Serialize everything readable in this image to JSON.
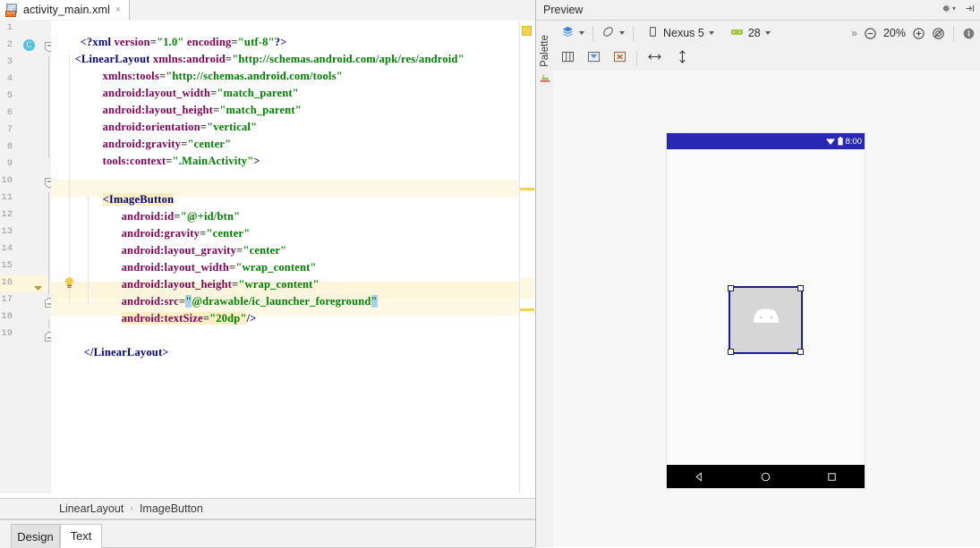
{
  "editor": {
    "tab": {
      "filename": "activity_main.xml",
      "close": "×",
      "icon": "xml-file-icon"
    },
    "line_numbers": [
      "1",
      "2",
      "3",
      "4",
      "5",
      "6",
      "7",
      "8",
      "9",
      "10",
      "11",
      "12",
      "13",
      "14",
      "15",
      "16",
      "17",
      "18",
      "19"
    ],
    "code": {
      "l1": "<?xml version=\"1.0\" encoding=\"utf-8\"?>",
      "l2": "<LinearLayout xmlns:android=\"http://schemas.android.com/apk/res/android\"",
      "l3": "xmlns:tools=\"http://schemas.android.com/tools\"",
      "l4": "android:layout_width=\"match_parent\"",
      "l5": "android:layout_height=\"match_parent\"",
      "l6": "android:orientation=\"vertical\"",
      "l7": "android:gravity=\"center\"",
      "l8": "tools:context=\".MainActivity\">",
      "l9": "",
      "l10": "<ImageButton",
      "l11": "android:id=\"@+id/btn\"",
      "l12": "android:gravity=\"center\"",
      "l13": "android:layout_gravity=\"center\"",
      "l14": "android:layout_width=\"wrap_content\"",
      "l15": "android:layout_height=\"wrap_content\"",
      "l16": "android:src=\"@drawable/ic_launcher_foreground\"",
      "l17": "android:textSize=\"20dp\"/>",
      "l18": "",
      "l19": "</LinearLayout>"
    },
    "tokens": {
      "pi_open": "<?xml",
      "pi_close": "?>",
      "attr_version": "version",
      "val_version": "\"1.0\"",
      "attr_encoding": "encoding",
      "val_encoding": "\"utf-8\"",
      "tag_linearlayout_open": "<LinearLayout",
      "tag_linearlayout_close": "</LinearLayout>",
      "tag_imagebutton": "<ImageButton",
      "ns_android": "xmlns:android",
      "ns_tools": "xmlns:tools",
      "val_android_ns": "\"http://schemas.android.com/apk/res/android\"",
      "val_tools_ns": "\"http://schemas.android.com/tools\"",
      "a_layout_width": "android:layout_width",
      "v_match_parent": "\"match_parent\"",
      "a_layout_height": "android:layout_height",
      "a_orientation": "android:orientation",
      "v_vertical": "\"vertical\"",
      "a_gravity": "android:gravity",
      "v_center": "\"center\"",
      "a_tools_context": "tools:context",
      "v_mainactivity": "\".MainActivity\"",
      "gt": ">",
      "a_id": "android:id",
      "v_id": "\"@+id/btn\"",
      "a_layout_gravity": "android:layout_gravity",
      "v_wrap_content": "\"wrap_content\"",
      "a_src": "android:src",
      "v_src_q1": "\"",
      "v_src_body": "@drawable/ic_launcher_foreground",
      "v_src_q2": "\"",
      "a_textsize": "android:textSize",
      "v_20dp": "\"20dp\"",
      "selfclose": "/>"
    },
    "gutter_icons": {
      "class_marker": "C",
      "bulb": "intention-bulb-icon",
      "fold_collapse": "fold-collapse-icon"
    },
    "breadcrumb": {
      "root": "LinearLayout",
      "separator": "›",
      "leaf": "ImageButton"
    },
    "bottom_tabs": [
      {
        "label": "Design",
        "active": false
      },
      {
        "label": "Text",
        "active": true
      }
    ]
  },
  "preview": {
    "header": {
      "title": "Preview",
      "gear_icon": "gear-icon",
      "gear_caret": "▾",
      "collapse_icon": "collapse-right-icon"
    },
    "palette": {
      "label": "Palette",
      "icon": "palette-icon"
    },
    "toolbar": {
      "layers_icon": "layers-icon",
      "layers_caret": "▾",
      "orientation_icon": "orientation-rotate-icon",
      "orientation_caret": "▾",
      "device_icon": "phone-icon",
      "device_label": "Nexus 5",
      "device_caret": "▾",
      "api_icon": "android-api-icon",
      "api_label": "28",
      "api_caret": "▾",
      "overflow": "»",
      "zoom_out_icon": "zoom-out-icon",
      "zoom_level": "20%",
      "zoom_in_icon": "zoom-in-icon",
      "zoom_fit_icon": "zoom-fit-icon",
      "info_icon": "info-icon"
    },
    "toolbar2": {
      "blueprint_icon": "show-layouts-icon",
      "constraints_icon": "show-constraints-icon",
      "errors_icon": "render-errors-icon",
      "expand_h_icon": "expand-horizontal-icon",
      "expand_v_icon": "expand-vertical-icon"
    },
    "device_frame": {
      "status_time": "8:00",
      "wifi_icon": "wifi-icon",
      "battery_icon": "battery-icon",
      "nav_back_icon": "nav-back-icon",
      "nav_home_icon": "nav-home-icon",
      "nav_recents_icon": "nav-recents-icon",
      "image_button": {
        "name": "btn",
        "drawable": "ic_launcher_foreground",
        "selected": true
      }
    }
  },
  "colors": {
    "tag": "#000080",
    "attribute": "#7f0055",
    "string": "#008000",
    "selection": "#a6d2f5",
    "caret_row": "#fdf6dd",
    "android_status_bar": "#2828b4",
    "selection_outline": "#1b1b8f"
  }
}
